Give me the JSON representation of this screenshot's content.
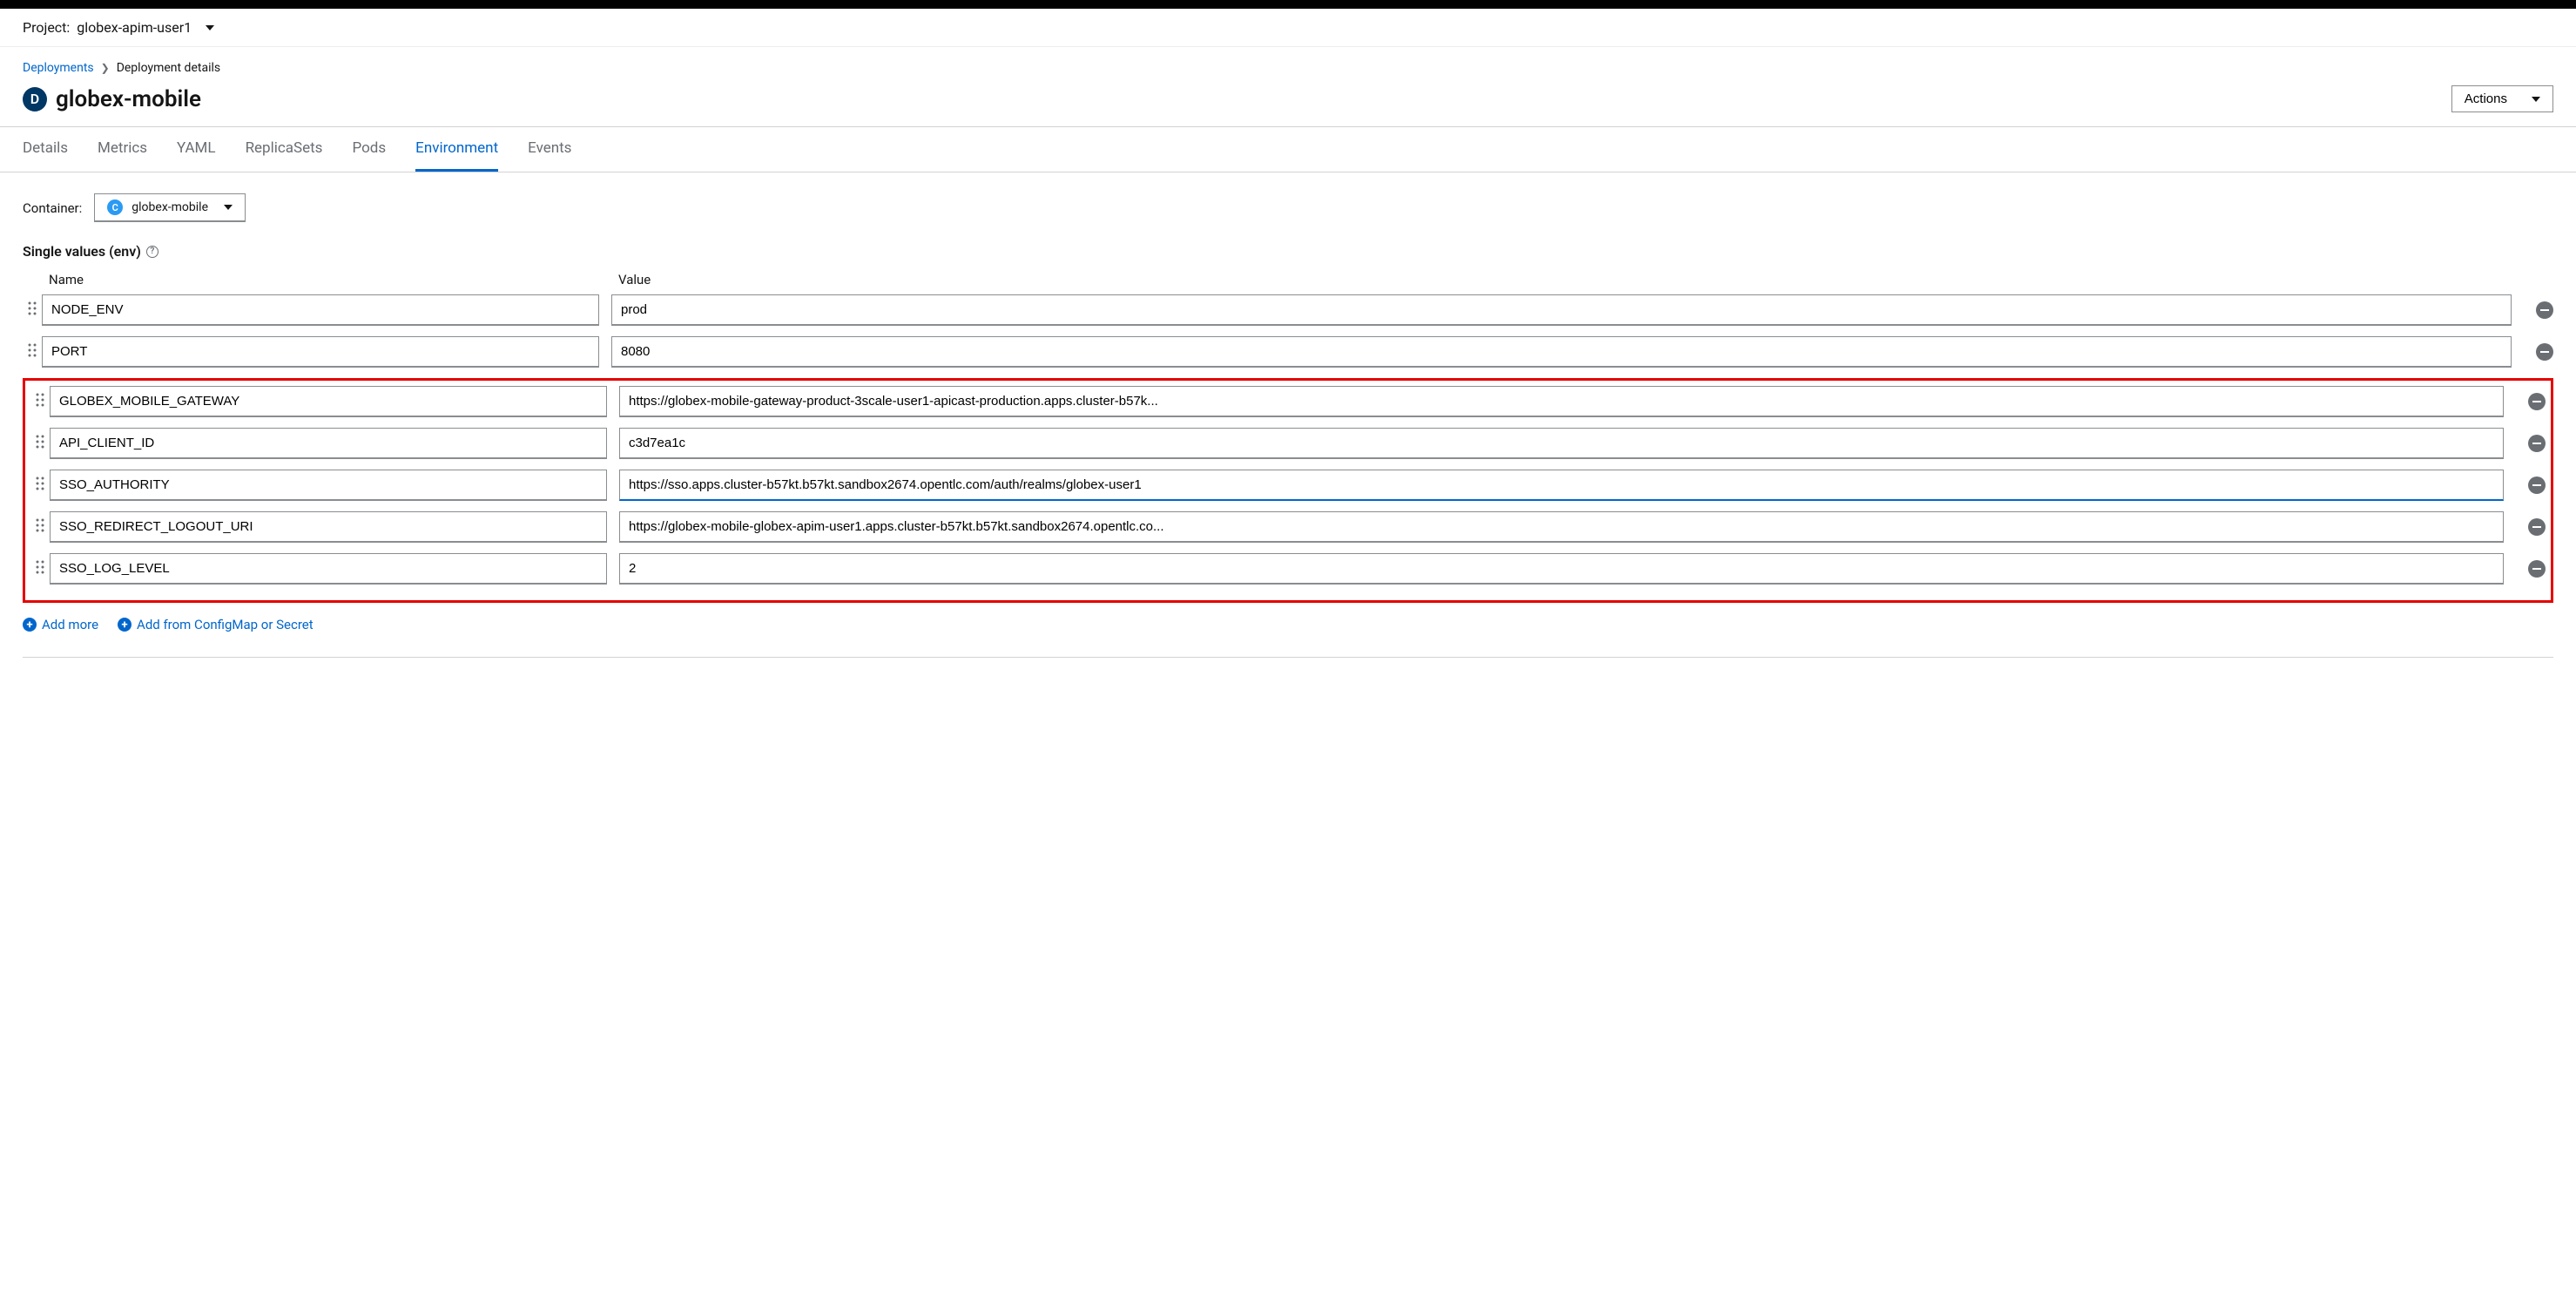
{
  "project": {
    "label": "Project:",
    "name": "globex-apim-user1"
  },
  "breadcrumbs": {
    "root": "Deployments",
    "current": "Deployment details"
  },
  "header": {
    "badge": "D",
    "title": "globex-mobile",
    "actions": "Actions"
  },
  "tabs": [
    {
      "label": "Details",
      "active": false
    },
    {
      "label": "Metrics",
      "active": false
    },
    {
      "label": "YAML",
      "active": false
    },
    {
      "label": "ReplicaSets",
      "active": false
    },
    {
      "label": "Pods",
      "active": false
    },
    {
      "label": "Environment",
      "active": true
    },
    {
      "label": "Events",
      "active": false
    }
  ],
  "container": {
    "label": "Container:",
    "badge": "C",
    "name": "globex-mobile"
  },
  "section": {
    "title": "Single values (env)"
  },
  "columns": {
    "name": "Name",
    "value": "Value"
  },
  "env": [
    {
      "name": "NODE_ENV",
      "value": "prod",
      "hl": false
    },
    {
      "name": "PORT",
      "value": "8080",
      "hl": false
    },
    {
      "name": "GLOBEX_MOBILE_GATEWAY",
      "value": "https://globex-mobile-gateway-product-3scale-user1-apicast-production.apps.cluster-b57k...",
      "hl": true
    },
    {
      "name": "API_CLIENT_ID",
      "value": "c3d7ea1c",
      "hl": true
    },
    {
      "name": "SSO_AUTHORITY",
      "value": "https://sso.apps.cluster-b57kt.b57kt.sandbox2674.opentlc.com/auth/realms/globex-user1",
      "hl": true,
      "focused": true
    },
    {
      "name": "SSO_REDIRECT_LOGOUT_URI",
      "value": "https://globex-mobile-globex-apim-user1.apps.cluster-b57kt.b57kt.sandbox2674.opentlc.co...",
      "hl": true
    },
    {
      "name": "SSO_LOG_LEVEL",
      "value": "2",
      "hl": true
    }
  ],
  "addLinks": {
    "more": "Add more",
    "configmap": "Add from ConfigMap or Secret"
  }
}
